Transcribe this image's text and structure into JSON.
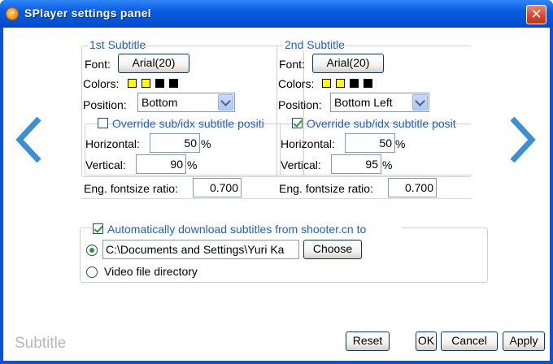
{
  "window": {
    "title": "SPlayer settings panel",
    "close_glyph": "✕"
  },
  "nav": {
    "prev": "chevron-left-icon",
    "next": "chevron-right-icon"
  },
  "sub1": {
    "legend": "1st Subtitle",
    "font_label": "Font:",
    "font_value": "Arial(20)",
    "colors_label": "Colors:",
    "colors": [
      "#ffff00",
      "#ffff00",
      "#000000",
      "#000000"
    ],
    "position_label": "Position:",
    "position_value": "Bottom",
    "override_label": "Override sub/idx subtitle positi",
    "override_checked": false,
    "horizontal_label": "Horizontal:",
    "horizontal_value": "50",
    "vertical_label": "Vertical:",
    "vertical_value": "90",
    "percent": "%",
    "ratio_label": "Eng. fontsize ratio:",
    "ratio_value": "0.700"
  },
  "sub2": {
    "legend": "2nd Subtitle",
    "font_label": "Font:",
    "font_value": "Arial(20)",
    "colors_label": "Colors:",
    "colors": [
      "#ffff00",
      "#ffff00",
      "#000000",
      "#000000"
    ],
    "position_label": "Position:",
    "position_value": "Bottom Left",
    "override_label": "Override sub/idx subtitle posit",
    "override_checked": true,
    "horizontal_label": "Horizontal:",
    "horizontal_value": "50",
    "vertical_label": "Vertical:",
    "vertical_value": "95",
    "percent": "%",
    "ratio_label": "Eng. fontsize ratio:",
    "ratio_value": "0.700"
  },
  "download": {
    "label": "Automatically download subtitles from shooter.cn to",
    "checked": true,
    "path_value": "C:\\Documents and Settings\\Yuri Ka",
    "choose_label": "Choose",
    "video_dir_label": "Video file directory",
    "selected": "path"
  },
  "footer": {
    "section_label": "Subtitle",
    "reset_label": "Reset",
    "ok_label": "OK",
    "cancel_label": "Cancel",
    "apply_label": "Apply"
  }
}
